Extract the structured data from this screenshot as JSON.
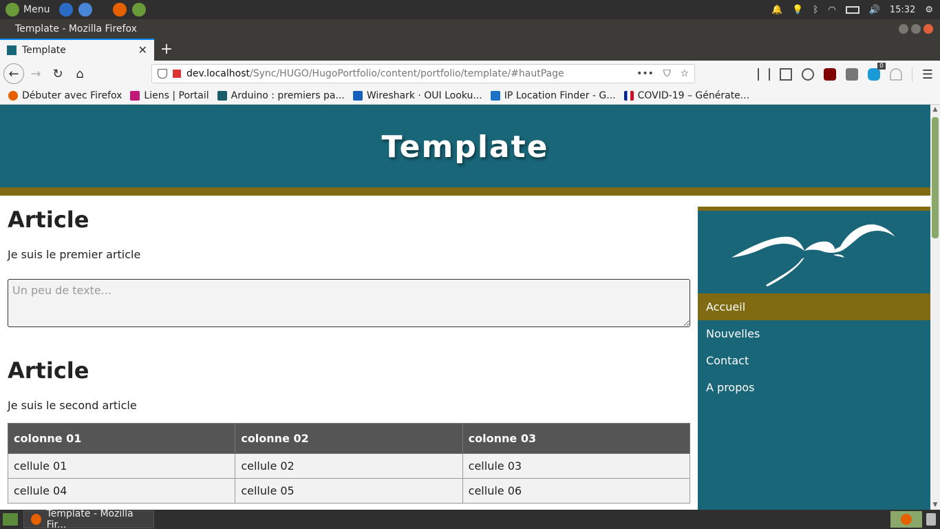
{
  "os_panel": {
    "menu_label": "Menu",
    "clock": "15:32"
  },
  "window": {
    "title": "Template - Mozilla Firefox"
  },
  "tabs": [
    {
      "label": "Template"
    }
  ],
  "nav": {
    "url_host": "dev.localhost",
    "url_path": "/Sync/HUGO/HugoPortfolio/content/portfolio/template/#hautPage",
    "url_more": "•••",
    "ext_badge": "0"
  },
  "bookmarks": [
    {
      "label": "Débuter avec Firefox",
      "color": "#e66000"
    },
    {
      "label": "Liens | Portail",
      "color": "#c2187a"
    },
    {
      "label": "Arduino : premiers pa...",
      "color": "#1a5c6a"
    },
    {
      "label": "Wireshark · OUI Looku...",
      "color": "#1560bd"
    },
    {
      "label": "IP Location Finder - G...",
      "color": "#1a73c8"
    },
    {
      "label": "COVID-19 – Générate...",
      "color": "#ce1126"
    }
  ],
  "page": {
    "site_title": "Template",
    "article1": {
      "heading": "Article",
      "text": "Je suis le premier article",
      "textarea_placeholder": "Un peu de texte..."
    },
    "article2": {
      "heading": "Article",
      "text": "Je suis le second article"
    },
    "table": {
      "headers": [
        "colonne 01",
        "colonne 02",
        "colonne 03"
      ],
      "rows": [
        [
          "cellule 01",
          "cellule 02",
          "cellule 03"
        ],
        [
          "cellule 04",
          "cellule 05",
          "cellule 06"
        ]
      ]
    },
    "sidebar_nav": [
      {
        "label": "Accueil",
        "active": true
      },
      {
        "label": "Nouvelles",
        "active": false
      },
      {
        "label": "Contact",
        "active": false
      },
      {
        "label": "A propos",
        "active": false
      }
    ]
  },
  "taskbar": {
    "window_label": "Template - Mozilla Fir..."
  },
  "colors": {
    "header_teal": "#196678",
    "accent_gold": "#806b12",
    "table_header": "#555555"
  }
}
